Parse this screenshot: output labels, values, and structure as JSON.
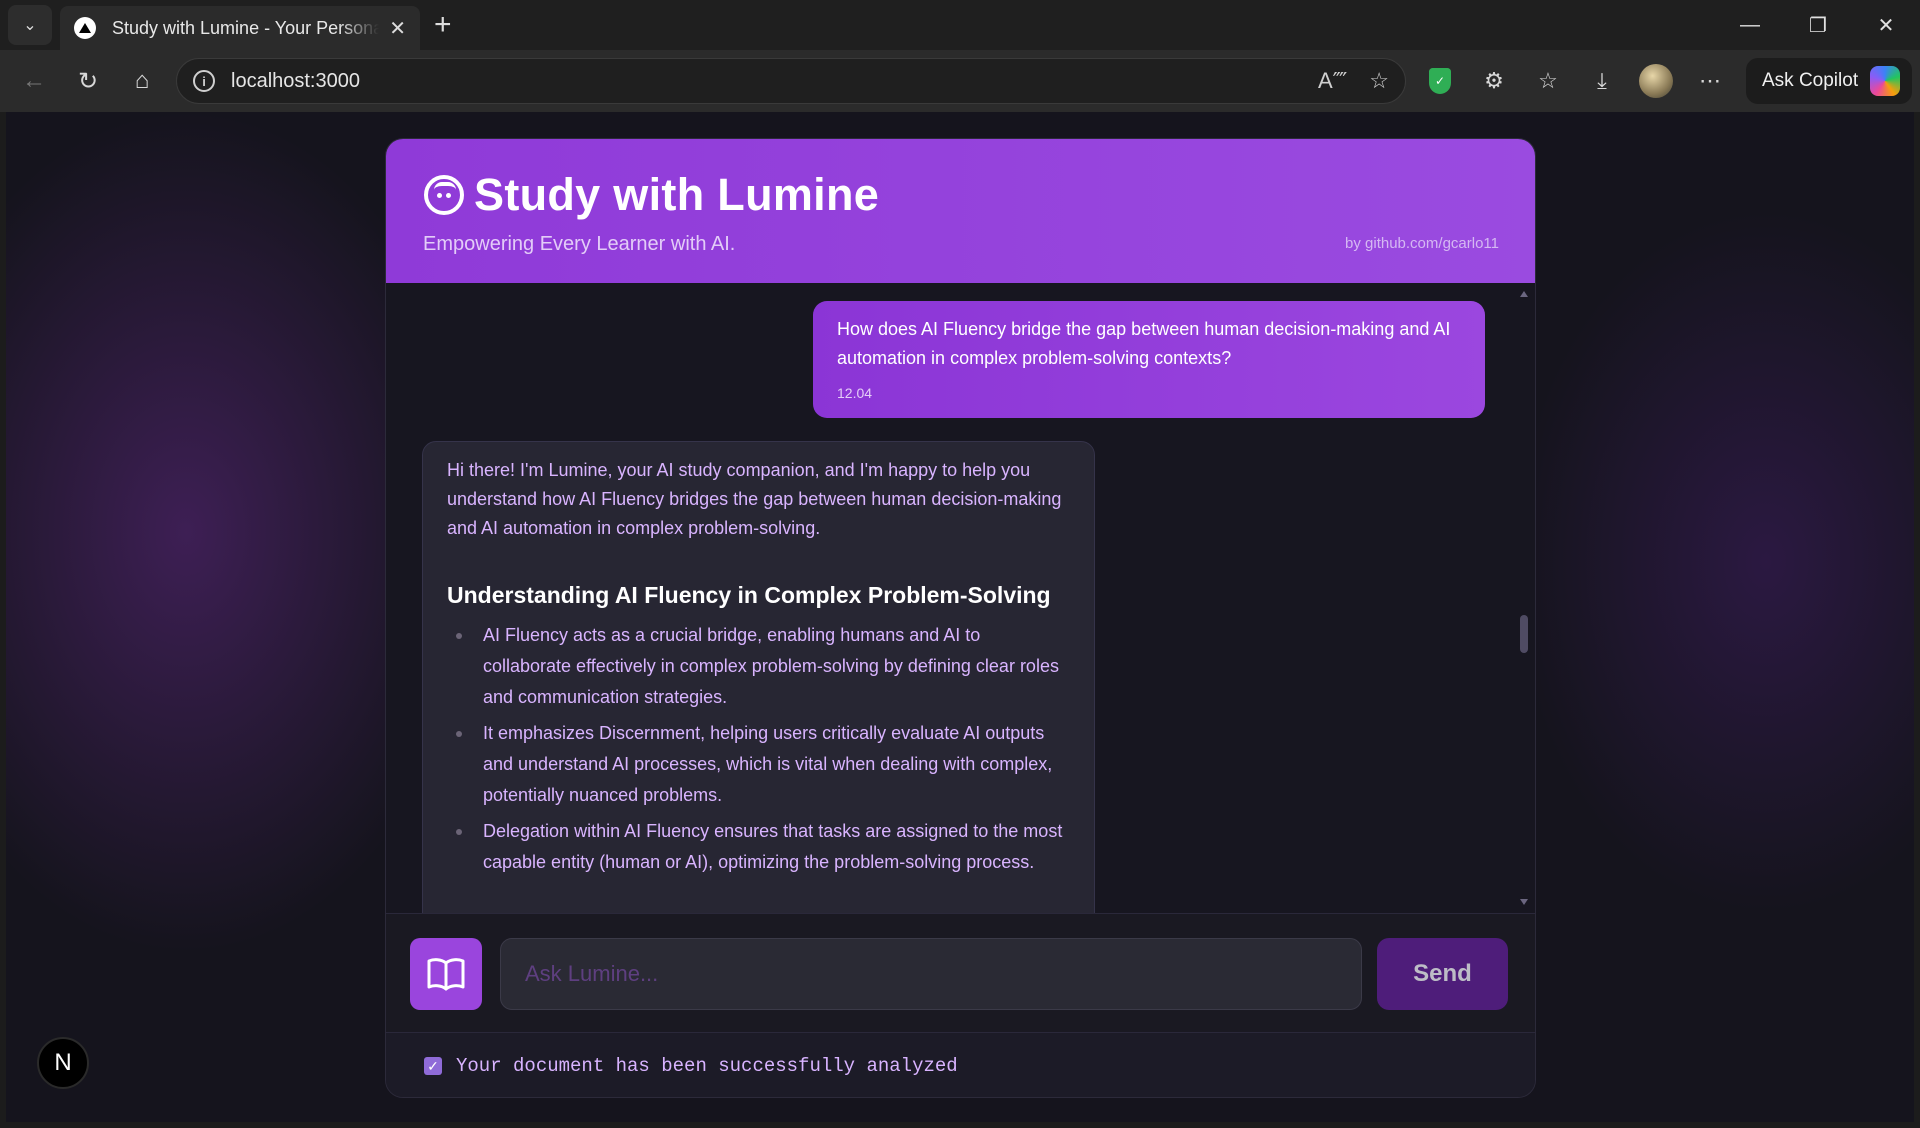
{
  "browser": {
    "tab_title": "Study with Lumine - Your Personal AI",
    "url": "localhost:3000",
    "ask_copilot": "Ask Copilot"
  },
  "app": {
    "title": "Study with Lumine",
    "tagline": "Empowering Every Learner with AI.",
    "credit": "by github.com/gcarlo11"
  },
  "chat": {
    "user_message": {
      "text": "How does AI Fluency bridge the gap between human decision-making and AI automation in complex problem-solving contexts?",
      "time": "12.04"
    },
    "bot_message": {
      "intro": "Hi there! I'm Lumine, your AI study companion, and I'm happy to help you understand how AI Fluency bridges the gap between human decision-making and AI automation in complex problem-solving.",
      "heading": "Understanding AI Fluency in Complex Problem-Solving",
      "bullets": [
        "AI Fluency acts as a crucial bridge, enabling humans and AI to collaborate effectively in complex problem-solving by defining clear roles and communication strategies.",
        "It emphasizes Discernment, helping users critically evaluate AI outputs and understand AI processes, which is vital when dealing with complex, potentially nuanced problems.",
        "Delegation within AI Fluency ensures that tasks are assigned to the most capable entity (human or AI), optimizing the problem-solving process."
      ]
    }
  },
  "composer": {
    "placeholder": "Ask Lumine...",
    "send_label": "Send"
  },
  "status": {
    "text": "Your document has been successfully analyzed",
    "checked": true
  },
  "dev_badge": "N",
  "colors": {
    "accent": "#9a45dd",
    "header": "#8f3ad8",
    "bot_text": "#d9b4ff"
  }
}
